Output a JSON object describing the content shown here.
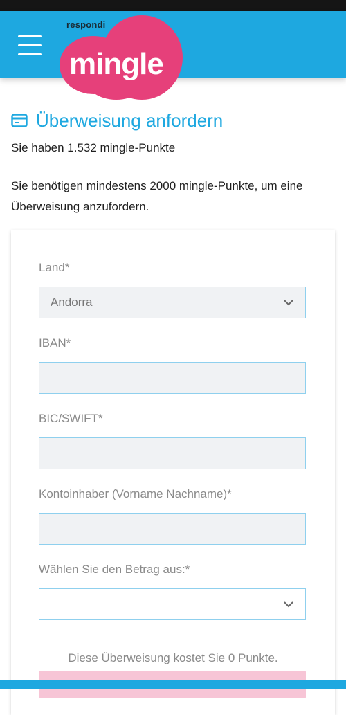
{
  "brand": {
    "tagline": "respondi",
    "name": "mingle",
    "accent_color": "#1ea8e0",
    "logo_color": "#e6407a"
  },
  "header": {
    "menu_icon": "hamburger-menu-icon"
  },
  "page": {
    "title": "Überweisung anfordern",
    "title_icon": "credit-card-icon",
    "points_text": "Sie haben 1.532 mingle-Punkte",
    "requirement_text": "Sie benötigen mindestens 2000 mingle-Punkte, um eine Überweisung anzufordern."
  },
  "form": {
    "country": {
      "label": "Land*",
      "value": "Andorra"
    },
    "iban": {
      "label": "IBAN*",
      "value": ""
    },
    "bic": {
      "label": "BIC/SWIFT*",
      "value": ""
    },
    "account_holder": {
      "label": "Kontoinhaber (Vorname Nachname)*",
      "value": ""
    },
    "amount": {
      "label": "Wählen Sie den Betrag aus:*",
      "value": ""
    },
    "cost_note": "Diese Überweisung kostet Sie 0 Punkte."
  }
}
